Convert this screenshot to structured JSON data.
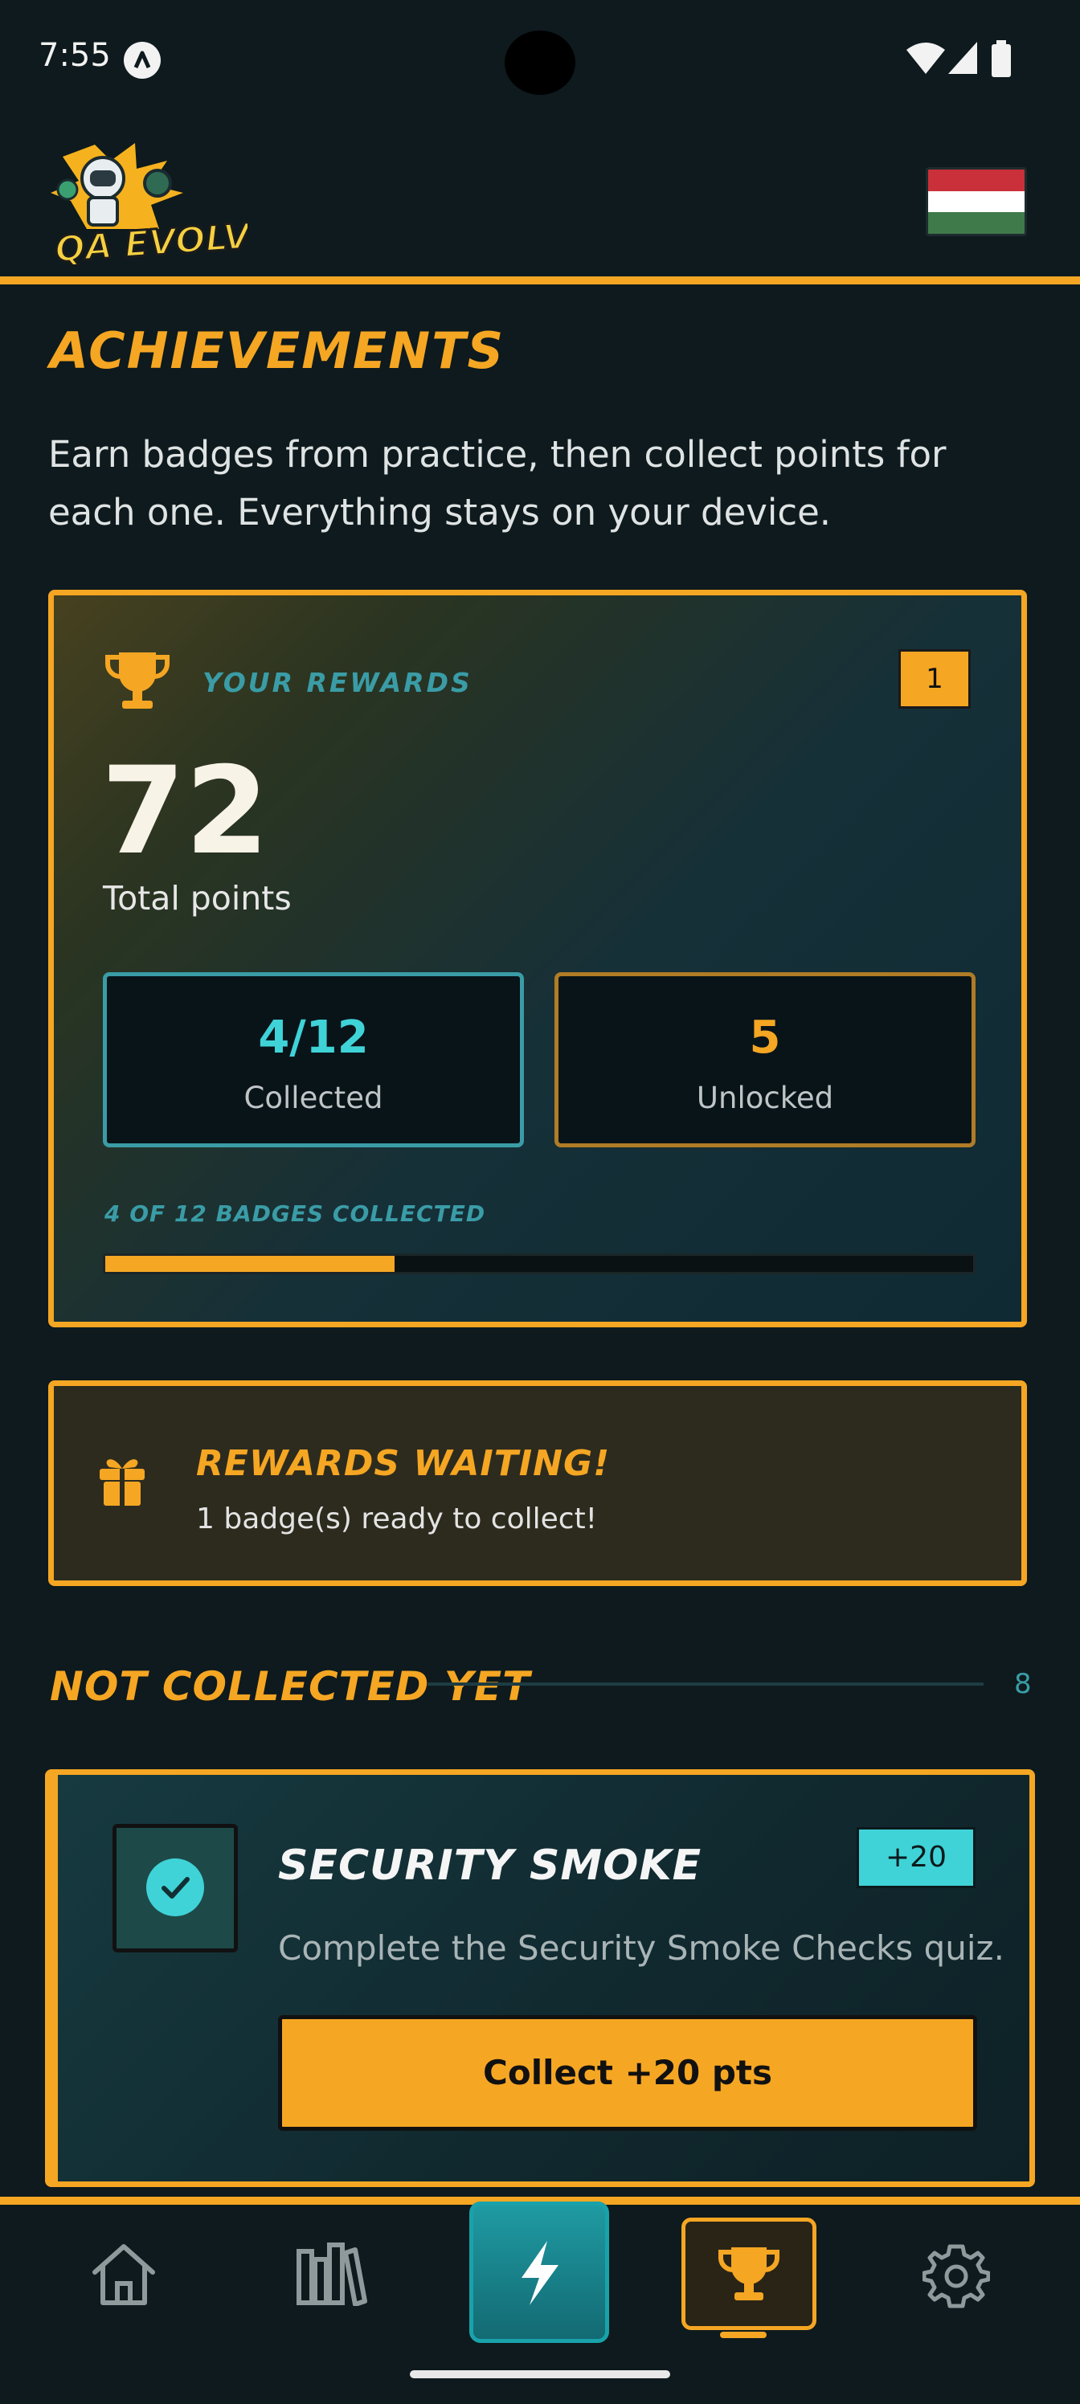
{
  "status_bar": {
    "time": "7:55"
  },
  "header": {
    "logo_text": "QA EVOLVE",
    "flag": "hungary-flag"
  },
  "page": {
    "title": "ACHIEVEMENTS",
    "subtitle": "Earn badges from practice, then collect points for each one. Everything stays on your device."
  },
  "rewards": {
    "label": "YOUR REWARDS",
    "level": "1",
    "points": "72",
    "points_label": "Total points",
    "collected_value": "4/12",
    "collected_label": "Collected",
    "unlocked_value": "5",
    "unlocked_label": "Unlocked",
    "progress_caption": "4 OF 12 BADGES COLLECTED",
    "progress_fraction": 0.333
  },
  "waiting": {
    "title": "REWARDS WAITING!",
    "text": "1 badge(s) ready to collect!"
  },
  "section": {
    "title": "NOT COLLECTED YET",
    "count": "8"
  },
  "badge": {
    "name": "SECURITY SMOKE",
    "points": "+20",
    "description": "Complete the Security Smoke Checks quiz.",
    "collect_label": "Collect +20 pts"
  },
  "nav": {
    "items": [
      "home-icon",
      "library-icon",
      "lightning-icon",
      "trophy-icon",
      "gear-icon"
    ],
    "active": "trophy-icon"
  },
  "colors": {
    "accent": "#f5a623",
    "teal": "#3a9ca6",
    "cyan": "#3fd3d8",
    "background": "#0e1a1d"
  }
}
